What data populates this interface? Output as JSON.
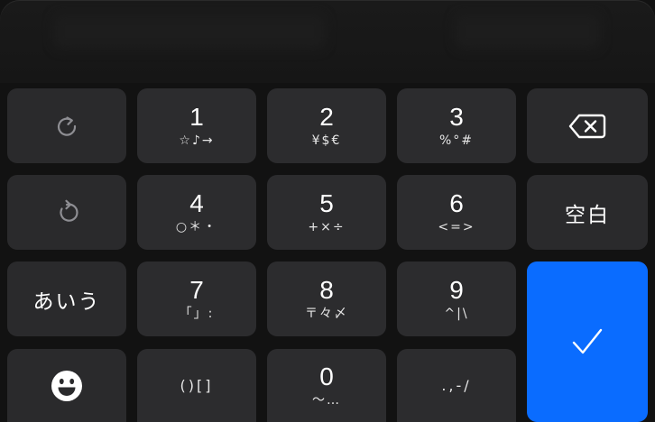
{
  "keyboard": {
    "colors": {
      "key": "#2c2c2e",
      "background": "#121212",
      "accent": "#0a6cff",
      "icon_muted": "#8e8e93"
    },
    "rows": [
      {
        "left": {
          "icon": "redo-icon"
        },
        "keys": [
          {
            "num": "1",
            "sub": "☆♪→"
          },
          {
            "num": "2",
            "sub": "¥$€"
          },
          {
            "num": "3",
            "sub": "%°#"
          }
        ],
        "right": {
          "icon": "backspace-icon"
        }
      },
      {
        "left": {
          "icon": "undo-icon"
        },
        "keys": [
          {
            "num": "4",
            "sub": "○＊・"
          },
          {
            "num": "5",
            "sub": "+×÷"
          },
          {
            "num": "6",
            "sub": "<=>"
          }
        ],
        "right": {
          "label": "空白"
        }
      },
      {
        "left": {
          "label": "あいう"
        },
        "keys": [
          {
            "num": "7",
            "sub": "「」:"
          },
          {
            "num": "8",
            "sub": "〒々〆"
          },
          {
            "num": "9",
            "sub": "^|\\"
          }
        ],
        "right": {
          "icon": "checkmark-icon"
        }
      },
      {
        "left": {
          "icon": "emoji-icon"
        },
        "keys": [
          {
            "single": "()[]"
          },
          {
            "num": "0",
            "sub": "〜…"
          },
          {
            "single": ".,-/"
          }
        ]
      }
    ]
  }
}
